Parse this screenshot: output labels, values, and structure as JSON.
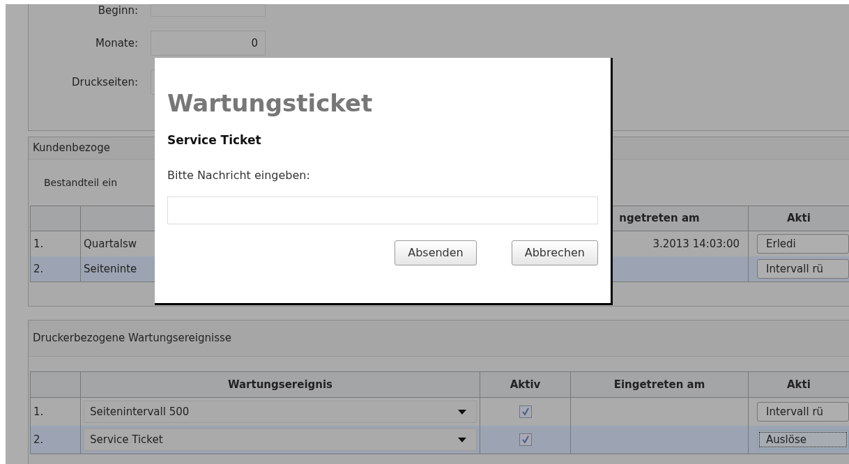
{
  "form_fields": [
    {
      "label": "Beginn:"
    },
    {
      "label": "Monate:",
      "value": "0"
    },
    {
      "label": "Druckseiten:"
    }
  ],
  "customer_events": {
    "title": "Kundenbezoge",
    "description": "Bestandteil ein",
    "columns": {
      "column_3": "ngetreten am",
      "column_4": "Akti"
    },
    "rows": [
      {
        "number": "1.",
        "event": "Quartalsw",
        "occurred": "3.2013 14:03:00",
        "action": "Erledi",
        "selected": false
      },
      {
        "number": "2.",
        "event": "Seiteninte",
        "action": "Intervall rü",
        "selected": true
      }
    ]
  },
  "printer_events": {
    "title": "Druckerbezogene Wartungsereignisse",
    "columns": [
      "Wartungsereignis",
      "Aktiv",
      "Eingetreten am",
      "Akti"
    ],
    "rows": [
      {
        "number": "1.",
        "event": "Seitenintervall 500",
        "active": true,
        "action": "Intervall rü",
        "selected": false,
        "focused": false
      },
      {
        "number": "2.",
        "event": "Service Ticket",
        "active": true,
        "action": "Auslöse",
        "selected": true,
        "focused": true
      }
    ]
  },
  "dialog": {
    "title": "Wartungsticket",
    "subtitle": "Service Ticket",
    "prompt": "Bitte Nachricht eingeben:",
    "buttons": [
      "Absenden",
      "Abbrechen"
    ]
  }
}
